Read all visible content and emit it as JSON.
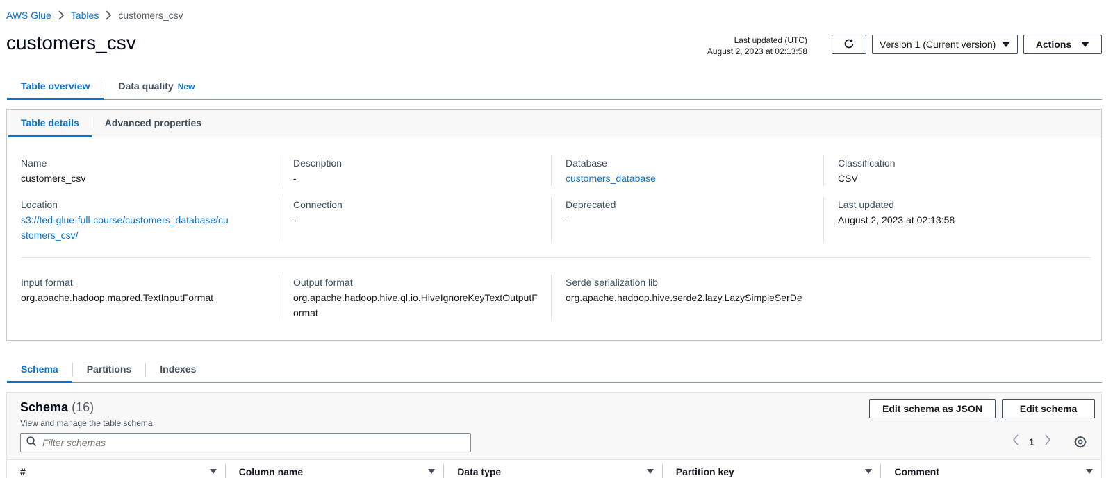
{
  "breadcrumb": {
    "items": [
      "AWS Glue",
      "Tables",
      "customers_csv"
    ]
  },
  "header": {
    "title": "customers_csv",
    "last_updated_label": "Last updated (UTC)",
    "last_updated_value": "August 2, 2023 at 02:13:58",
    "version_label": "Version 1 (Current version)",
    "actions_label": "Actions"
  },
  "top_tabs": {
    "overview": "Table overview",
    "data_quality": "Data quality",
    "new_badge": "New"
  },
  "detail_tabs": {
    "table_details": "Table details",
    "advanced": "Advanced properties"
  },
  "details": {
    "name": {
      "label": "Name",
      "value": "customers_csv"
    },
    "description": {
      "label": "Description",
      "value": "-"
    },
    "database": {
      "label": "Database",
      "value": "customers_database"
    },
    "classification": {
      "label": "Classification",
      "value": "CSV"
    },
    "location": {
      "label": "Location",
      "value": "s3://ted-glue-full-course/customers_database/customers_csv/"
    },
    "connection": {
      "label": "Connection",
      "value": "-"
    },
    "deprecated": {
      "label": "Deprecated",
      "value": "-"
    },
    "last_updated": {
      "label": "Last updated",
      "value": "August 2, 2023 at 02:13:58"
    },
    "input_format": {
      "label": "Input format",
      "value": "org.apache.hadoop.mapred.TextInputFormat"
    },
    "output_format": {
      "label": "Output format",
      "value": "org.apache.hadoop.hive.ql.io.HiveIgnoreKeyTextOutputFormat"
    },
    "serde": {
      "label": "Serde serialization lib",
      "value": "org.apache.hadoop.hive.serde2.lazy.LazySimpleSerDe"
    }
  },
  "schema_tabs": {
    "schema": "Schema",
    "partitions": "Partitions",
    "indexes": "Indexes"
  },
  "schema": {
    "title": "Schema",
    "count": "(16)",
    "description": "View and manage the table schema.",
    "edit_json_label": "Edit schema as JSON",
    "edit_label": "Edit schema",
    "filter_placeholder": "Filter schemas",
    "page": "1",
    "columns": [
      "#",
      "Column name",
      "Data type",
      "Partition key",
      "Comment"
    ]
  },
  "colors": {
    "accent": "#0972d3",
    "text": "#16191f",
    "border": "#c4c8cc"
  },
  "icons": [
    "chevron-right-icon",
    "refresh-icon",
    "caret-down-icon",
    "search-icon",
    "chevron-left-icon",
    "settings-gear-icon",
    "sort-caret-icon"
  ]
}
